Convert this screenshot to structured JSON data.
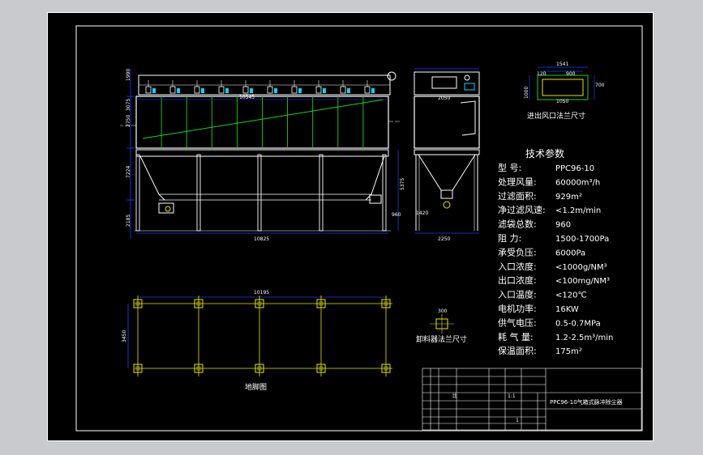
{
  "colors": {
    "frame": "#ffffff",
    "dimension": "#1a3cff",
    "green_structure": "#15d615",
    "yellow_foundation": "#e8e800",
    "cyan": "#00d8ff",
    "background": "#000000",
    "outer_bg": "#c8cacd"
  },
  "top_flange": {
    "dims": [
      "1541",
      "1050",
      "700",
      "1000",
      "120",
      "900"
    ],
    "caption": "进出风口法兰尺寸"
  },
  "front_view": {
    "dims": [
      "1990",
      "3075",
      "2750",
      "7224",
      "5375",
      "10825",
      "2185",
      "10545",
      "960"
    ]
  },
  "side_view": {
    "dims": [
      "2250",
      "2050",
      "1420"
    ]
  },
  "specs": {
    "title": "技术参数",
    "rows": [
      {
        "label": "型      号:",
        "value": "PPC96-10"
      },
      {
        "label": "处理风量:",
        "value": "60000m³/h"
      },
      {
        "label": "过滤面积:",
        "value": "929m²"
      },
      {
        "label": "净过滤风速:",
        "value": "<1.2m/min"
      },
      {
        "label": "滤袋总数:",
        "value": "960"
      },
      {
        "label": "阻      力:",
        "value": "1500-1700Pa"
      },
      {
        "label": "承受负压:",
        "value": "6000Pa"
      },
      {
        "label": "入口浓度:",
        "value": "<1000g/NM³"
      },
      {
        "label": "出口浓度:",
        "value": "<100mg/NM³"
      },
      {
        "label": "入口温度:",
        "value": "<120℃"
      },
      {
        "label": "电机功率:",
        "value": "16KW"
      },
      {
        "label": "供气电压:",
        "value": "0.5-0.7MPa"
      },
      {
        "label": "耗  气  量:",
        "value": "1.2-2.5m³/min"
      },
      {
        "label": "保温面积:",
        "value": "175m²"
      }
    ]
  },
  "foundation": {
    "caption": "地脚图",
    "dims": [
      "10195",
      "3450"
    ]
  },
  "discharge": {
    "caption": "卸料器法兰尺寸",
    "dim": "300"
  },
  "title_block": {
    "drawing_name": "PPC96-10气箱式脉冲除尘器",
    "cells": [
      "比",
      "1:1",
      "1"
    ]
  }
}
